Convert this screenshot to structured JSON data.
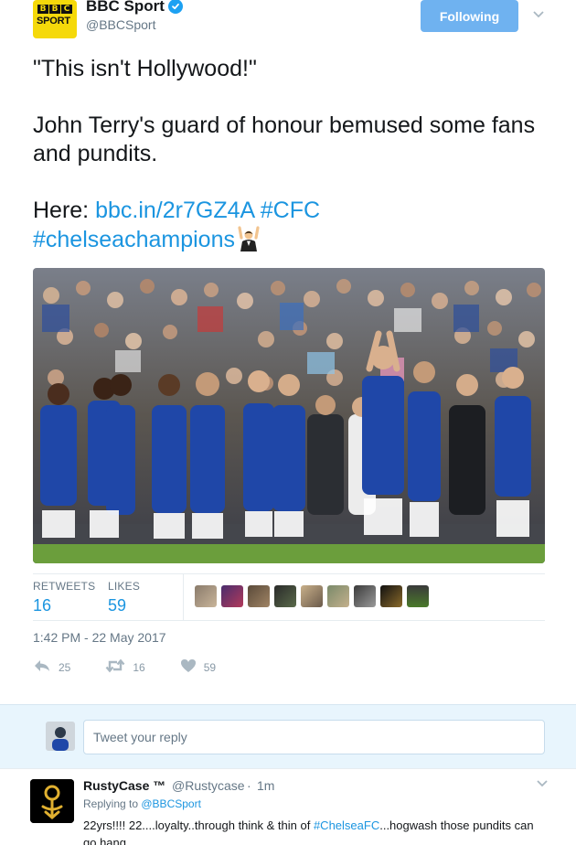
{
  "author": {
    "display_name": "BBC Sport",
    "handle": "@BBCSport",
    "avatar_line1": [
      "B",
      "B",
      "C"
    ],
    "avatar_line2": "SPORT",
    "verified": true
  },
  "follow_button": "Following",
  "tweet": {
    "line1": "\"This isn't Hollywood!\"",
    "line2": "John Terry's guard of honour bemused some fans and pundits.",
    "here_prefix": "Here: ",
    "link": "bbc.in/2r7GZ4A",
    "hashtag1": "#CFC",
    "hashtag2": "#chelseachampions",
    "emoji": "person-raising-hands"
  },
  "stats": {
    "retweets_label": "RETWEETS",
    "retweets_value": "16",
    "likes_label": "LIKES",
    "likes_value": "59"
  },
  "timestamp": "1:42 PM - 22 May 2017",
  "actions": {
    "reply_count": "25",
    "retweet_count": "16",
    "like_count": "59"
  },
  "reply_box": {
    "placeholder": "Tweet your reply"
  },
  "reply": {
    "name": "RustyCase ™",
    "handle": "@Rustycase",
    "separator": "·",
    "time": "1m",
    "replying_prefix": "Replying to ",
    "replying_to": "@BBCSport",
    "text_before": "22yrs!!!! 22....loyalty..through think & thin of ",
    "text_hashtag": "#ChelseaFC",
    "text_after": "...hogwash those pundits can go hang"
  },
  "colors": {
    "accent": "#1b95e0",
    "follow_button": "#6fb2f0",
    "reply_bar": "#e8f5fd",
    "muted": "#657786"
  }
}
